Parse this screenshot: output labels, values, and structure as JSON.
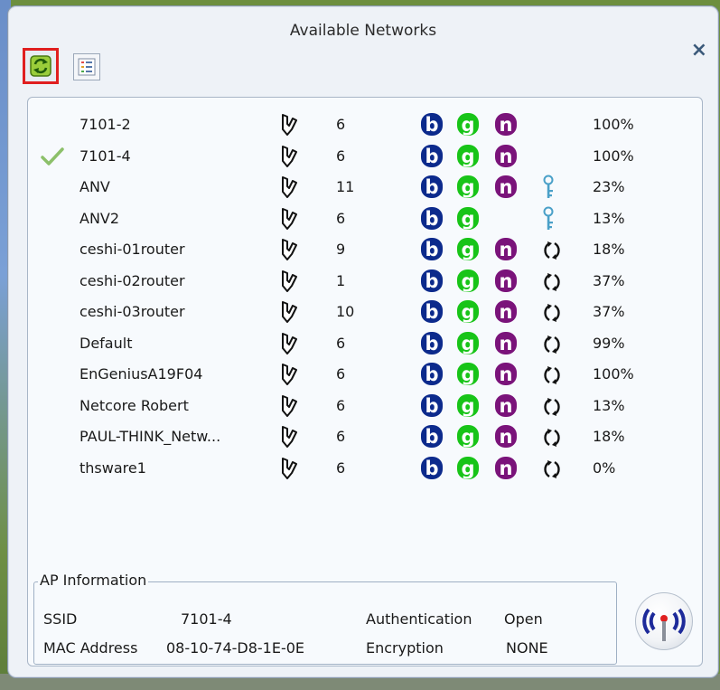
{
  "window": {
    "title": "Available Networks",
    "close_symbol": "×"
  },
  "toolbar": {
    "refresh_icon": "refresh-icon",
    "list_icon": "list-view-icon"
  },
  "networks": [
    {
      "ssid": "7101-2",
      "channel": "6",
      "modes": [
        "b",
        "g",
        "n"
      ],
      "key": false,
      "wps": false,
      "signal": "100%",
      "connected": false
    },
    {
      "ssid": "7101-4",
      "channel": "6",
      "modes": [
        "b",
        "g",
        "n"
      ],
      "key": false,
      "wps": false,
      "signal": "100%",
      "connected": true
    },
    {
      "ssid": "ANV",
      "channel": "11",
      "modes": [
        "b",
        "g",
        "n"
      ],
      "key": true,
      "wps": false,
      "signal": "23%",
      "connected": false
    },
    {
      "ssid": "ANV2",
      "channel": "6",
      "modes": [
        "b",
        "g"
      ],
      "key": true,
      "wps": false,
      "signal": "13%",
      "connected": false
    },
    {
      "ssid": "ceshi-01router",
      "channel": "9",
      "modes": [
        "b",
        "g",
        "n"
      ],
      "key": false,
      "wps": true,
      "signal": "18%",
      "connected": false
    },
    {
      "ssid": "ceshi-02router",
      "channel": "1",
      "modes": [
        "b",
        "g",
        "n"
      ],
      "key": false,
      "wps": true,
      "signal": "37%",
      "connected": false
    },
    {
      "ssid": "ceshi-03router",
      "channel": "10",
      "modes": [
        "b",
        "g",
        "n"
      ],
      "key": false,
      "wps": true,
      "signal": "37%",
      "connected": false
    },
    {
      "ssid": "Default",
      "channel": "6",
      "modes": [
        "b",
        "g",
        "n"
      ],
      "key": false,
      "wps": true,
      "signal": "99%",
      "connected": false
    },
    {
      "ssid": "EnGeniusA19F04",
      "channel": "6",
      "modes": [
        "b",
        "g",
        "n"
      ],
      "key": false,
      "wps": true,
      "signal": "100%",
      "connected": false
    },
    {
      "ssid": "Netcore Robert",
      "channel": "6",
      "modes": [
        "b",
        "g",
        "n"
      ],
      "key": false,
      "wps": true,
      "signal": "13%",
      "connected": false
    },
    {
      "ssid": "PAUL-THINK_Netw...",
      "channel": "6",
      "modes": [
        "b",
        "g",
        "n"
      ],
      "key": false,
      "wps": true,
      "signal": "18%",
      "connected": false
    },
    {
      "ssid": "thsware1",
      "channel": "6",
      "modes": [
        "b",
        "g",
        "n"
      ],
      "key": false,
      "wps": true,
      "signal": "0%",
      "connected": false
    }
  ],
  "mode_colors": {
    "b": "#0c2a8c",
    "g": "#18c418",
    "n": "#7a137a"
  },
  "ap_info": {
    "legend": "AP Information",
    "ssid_label": "SSID",
    "ssid_value": "7101-4",
    "mac_label": "MAC Address",
    "mac_value": "08-10-74-D8-1E-0E",
    "auth_label": "Authentication",
    "auth_value": "Open",
    "enc_label": "Encryption",
    "enc_value": "NONE"
  },
  "connect_button": {
    "icon": "wireless-antenna-icon"
  }
}
